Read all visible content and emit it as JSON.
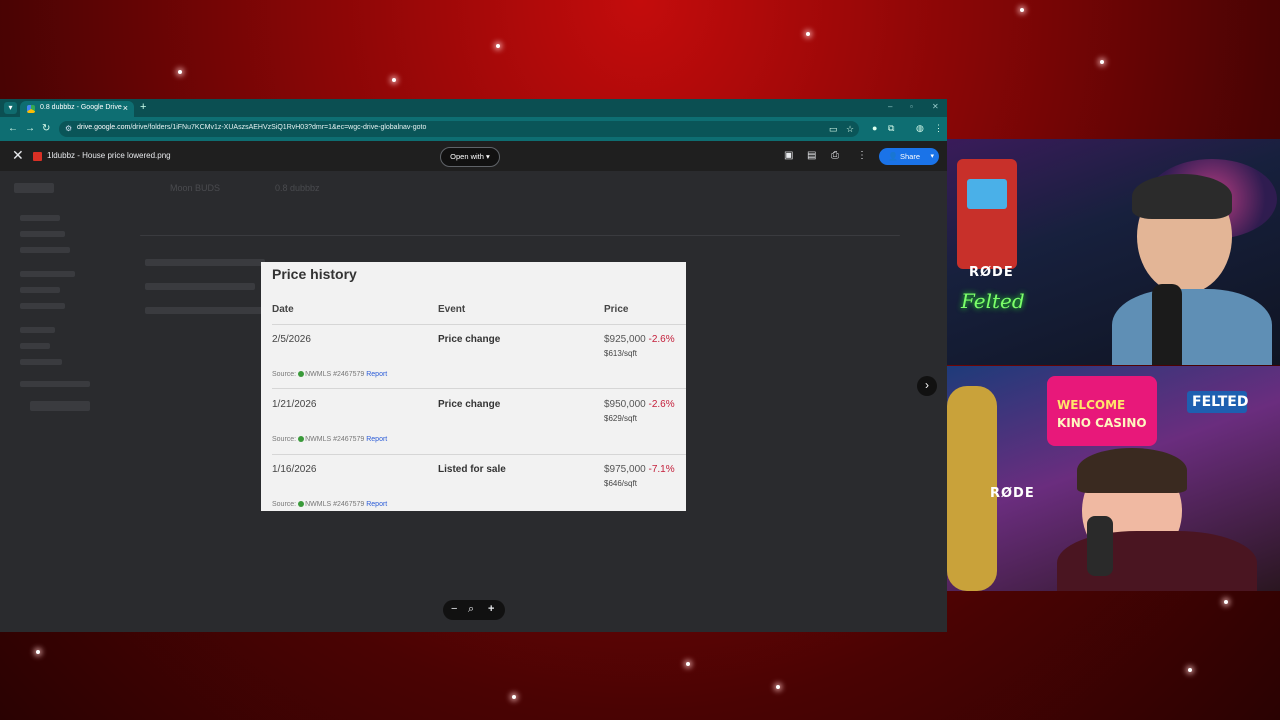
{
  "browser": {
    "tab_title": "0.8 dubbbz - Google Drive",
    "url_host": "drive.google.com",
    "url_path": "/drive/folders/1iFNu7KCMv1z-XUAszsAEHVzSiQ1RvH03?dmr=1&ec=wgc-drive-globalnav-goto",
    "new_tab_glyph": "+",
    "close_tab_glyph": "×",
    "colors": {
      "tabstrip": "#0b4f52",
      "toolbar": "#0e6e72"
    }
  },
  "viewer": {
    "filename": "1ldubbz - House price lowered.png",
    "open_with_label": "Open with",
    "share_label": "Share",
    "close_glyph": "✕",
    "icons": [
      "add-to-folder-icon",
      "comment-icon",
      "print-icon",
      "more-vert-icon"
    ]
  },
  "drive_background": {
    "breadcrumb_1": "Moon BUDS",
    "breadcrumb_2": "0.8 dubbbz"
  },
  "image": {
    "title": "Price history",
    "columns": {
      "date": "Date",
      "event": "Event",
      "price": "Price"
    },
    "rows": [
      {
        "date": "2/5/2026",
        "event": "Price change",
        "price": "$925,000",
        "change": "-2.6%",
        "sqft": "$613/sqft",
        "source": "Source:",
        "source_id": "NWMLS #2467579",
        "report": "Report"
      },
      {
        "date": "1/21/2026",
        "event": "Price change",
        "price": "$950,000",
        "change": "-2.6%",
        "sqft": "$629/sqft",
        "source": "Source:",
        "source_id": "NWMLS #2467579",
        "report": "Report"
      },
      {
        "date": "1/16/2026",
        "event": "Listed for sale",
        "price": "$975,000",
        "change": "-7.1%",
        "sqft": "$646/sqft",
        "source": "Source:",
        "source_id": "NWMLS #2467579",
        "report": "Report"
      }
    ]
  },
  "zoom": {
    "out": "−",
    "reset": "⌕",
    "in": "+"
  },
  "next_glyph": "›",
  "webcams": {
    "cam1": {
      "mic_brand": "RØDE",
      "neon": "Felted"
    },
    "cam2": {
      "mic_brand": "RØDE",
      "sign_welcome": "WELCOME",
      "sign_casino": "KINO CASINO",
      "sign_felted": "FELTED"
    }
  }
}
